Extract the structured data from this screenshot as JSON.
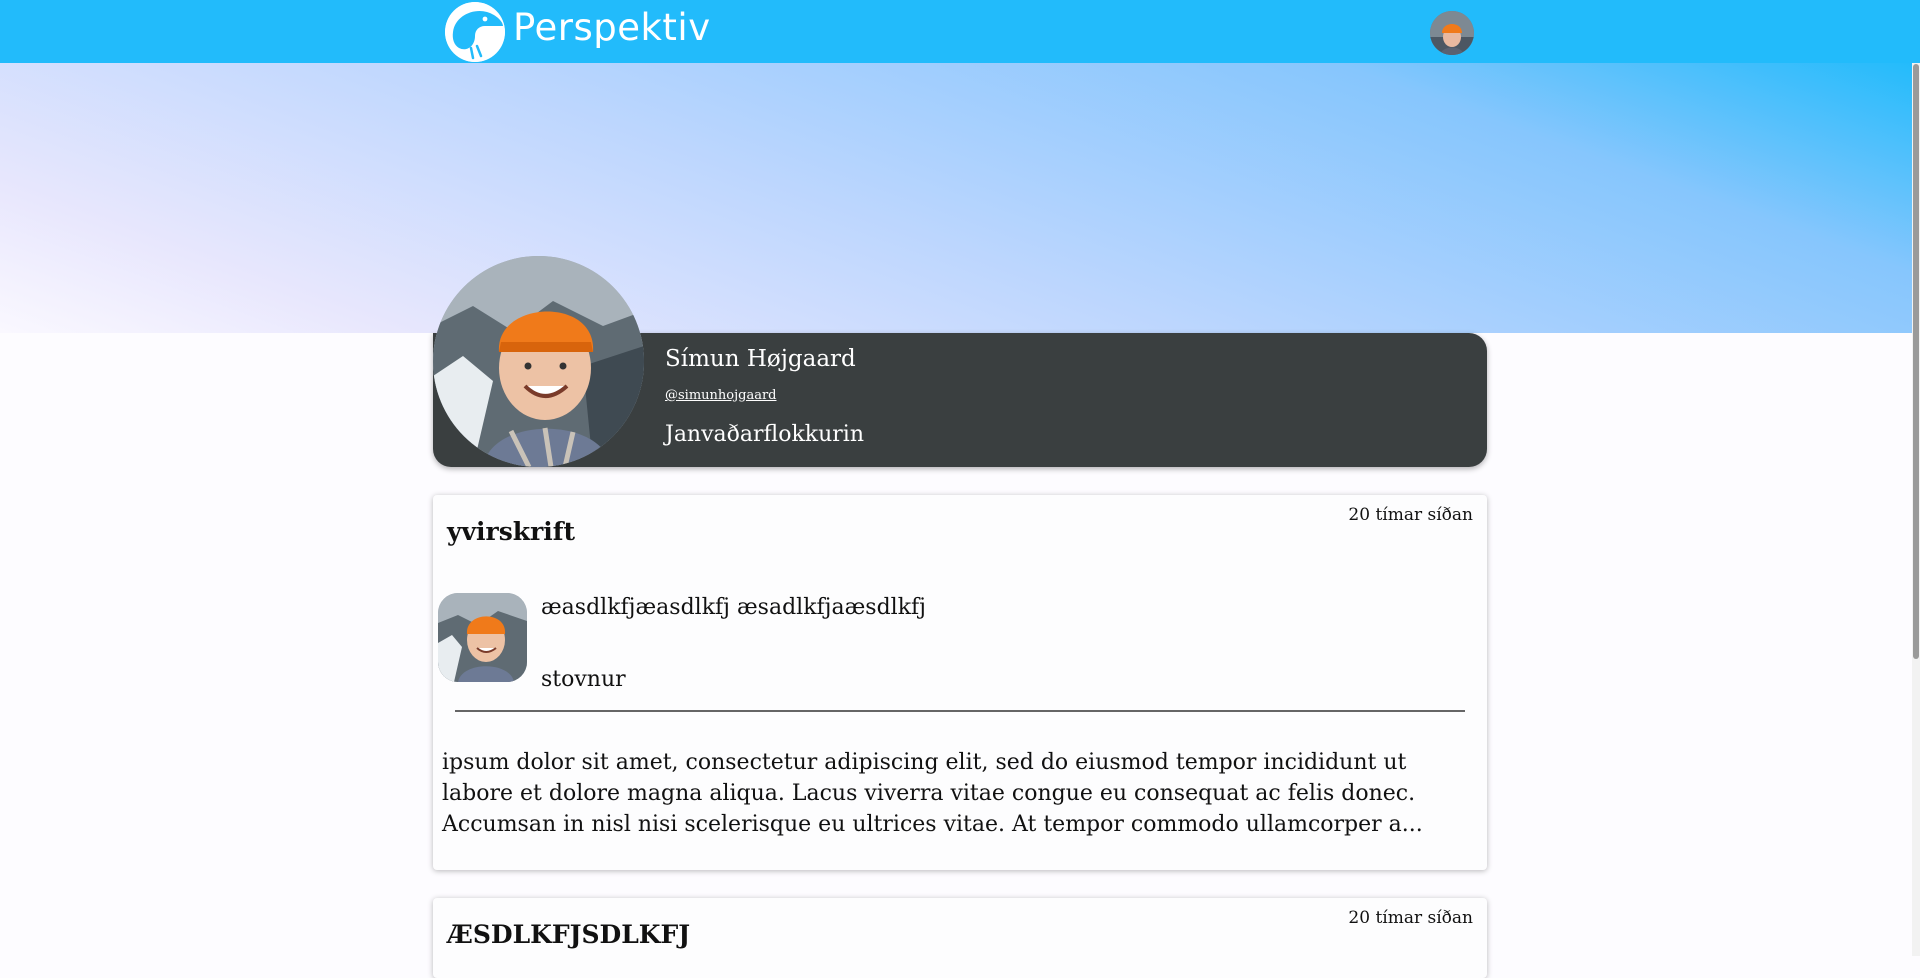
{
  "header": {
    "logo_text": "Perspektiv",
    "logo_icon": "bird-logo-icon",
    "user_avatar": "user-avatar"
  },
  "profile": {
    "name": "Símun Højgaard",
    "handle": "@simunhojgaard",
    "party": "Janvaðarflokkurin"
  },
  "posts": [
    {
      "title": "yvirskrift",
      "time": "20 tímar síðan",
      "author": "æasdlkfjæasdlkfj æsadlkfjaæsdlkfj",
      "role": "stovnur",
      "body": "ipsum dolor sit amet, consectetur adipiscing elit, sed do eiusmod tempor incididunt ut labore et dolore magna aliqua. Lacus viverra vitae congue eu consequat ac felis donec. Accumsan in nisl nisi scelerisque eu ultrices vitae. At tempor commodo ullamcorper a..."
    },
    {
      "title": "ÆSDLKFJSDLKFJ",
      "time": "20 tímar síðan"
    }
  ],
  "colors": {
    "topbar": "#22bbfb",
    "profile_card": "#3a3f40",
    "hat": "#f07a1a"
  }
}
